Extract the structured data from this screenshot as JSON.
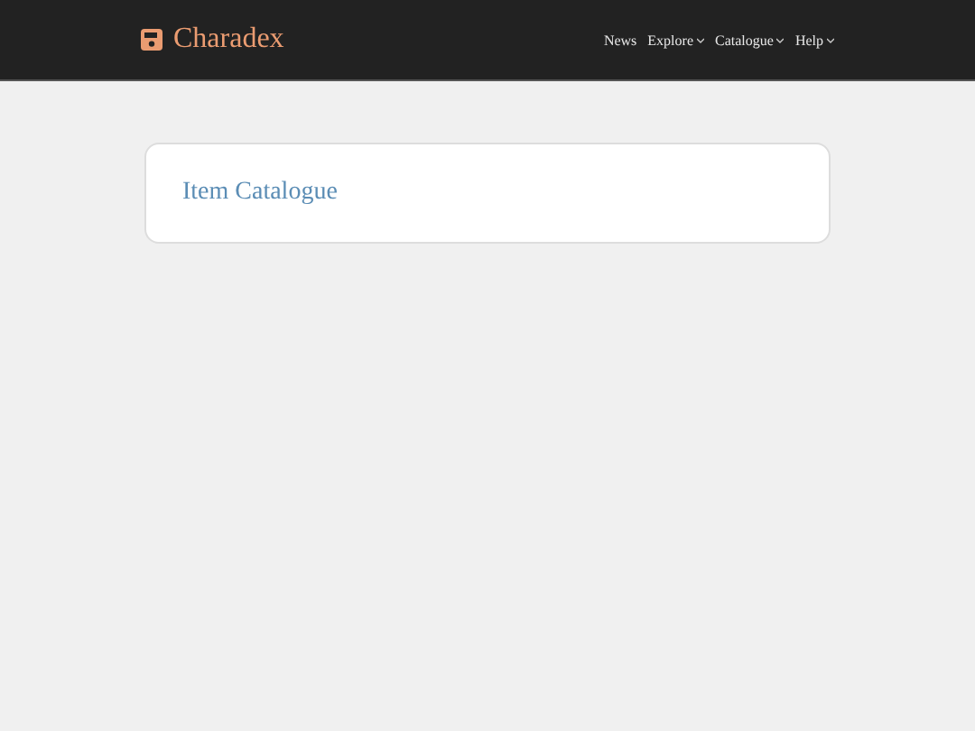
{
  "navbar": {
    "brand": "Charadex",
    "links": [
      {
        "label": "News",
        "dropdown": false
      },
      {
        "label": "Explore",
        "dropdown": true
      },
      {
        "label": "Catalogue",
        "dropdown": true
      },
      {
        "label": "Help",
        "dropdown": true
      }
    ]
  },
  "card": {
    "title": "Item Catalogue"
  }
}
